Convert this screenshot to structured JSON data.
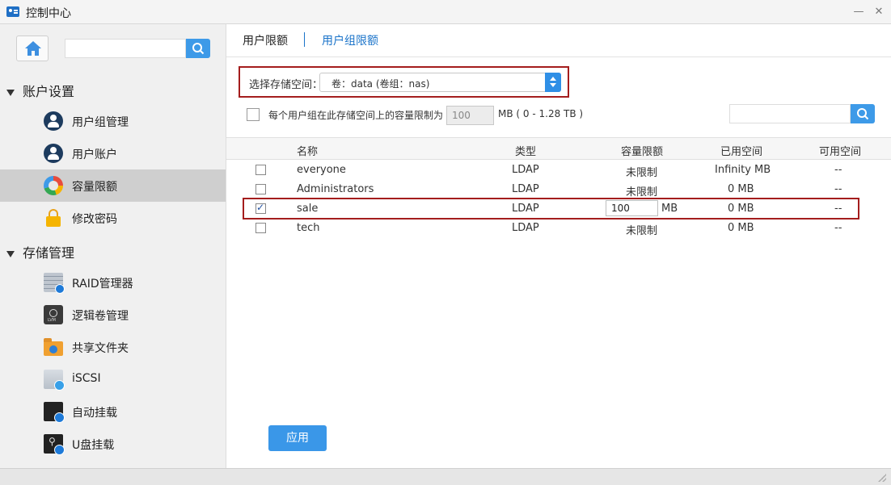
{
  "window": {
    "title": "控制中心",
    "minimize": "—",
    "close": "✕"
  },
  "sidebar": {
    "search_placeholder": "",
    "sections": [
      {
        "title": "账户设置",
        "items": [
          {
            "label": "用户组管理",
            "icon": "user-group-icon"
          },
          {
            "label": "用户账户",
            "icon": "user-icon"
          },
          {
            "label": "容量限额",
            "icon": "quota-icon",
            "active": true
          },
          {
            "label": "修改密码",
            "icon": "lock-icon"
          }
        ]
      },
      {
        "title": "存储管理",
        "items": [
          {
            "label": "RAID管理器",
            "icon": "raid-icon"
          },
          {
            "label": "逻辑卷管理",
            "icon": "lvm-icon"
          },
          {
            "label": "共享文件夹",
            "icon": "shared-folder-icon"
          },
          {
            "label": "iSCSI",
            "icon": "iscsi-icon"
          },
          {
            "label": "自动挂载",
            "icon": "auto-mount-icon"
          },
          {
            "label": "U盘挂载",
            "icon": "usb-mount-icon"
          }
        ]
      }
    ]
  },
  "tabs": [
    {
      "label": "用户限额",
      "active": true
    },
    {
      "label": "用户组限额",
      "active": false
    }
  ],
  "storage": {
    "label": "选择存储空间：",
    "selected": "卷：data (卷组：nas)"
  },
  "group_limit": {
    "checked": false,
    "label": "每个用户组在此存储空间上的容量限制为",
    "value": "100",
    "unit": "MB ( 0 - 1.28 TB )"
  },
  "table": {
    "headers": [
      "名称",
      "类型",
      "容量限额",
      "已用空间",
      "可用空间"
    ],
    "rows": [
      {
        "checked": false,
        "name": "everyone",
        "type": "LDAP",
        "quota": "未限制",
        "used": "Infinity MB",
        "avail": "--"
      },
      {
        "checked": false,
        "name": "Administrators",
        "type": "LDAP",
        "quota": "未限制",
        "used": "0 MB",
        "avail": "--"
      },
      {
        "checked": true,
        "name": "sale",
        "type": "LDAP",
        "quota_value": "100",
        "quota_unit": "MB",
        "used": "0 MB",
        "avail": "--"
      },
      {
        "checked": false,
        "name": "tech",
        "type": "LDAP",
        "quota": "未限制",
        "used": "0 MB",
        "avail": "--"
      }
    ]
  },
  "apply_label": "应用",
  "colors": {
    "accent": "#3a97e8",
    "highlight": "#a41d1d",
    "link": "#1a73c9"
  }
}
